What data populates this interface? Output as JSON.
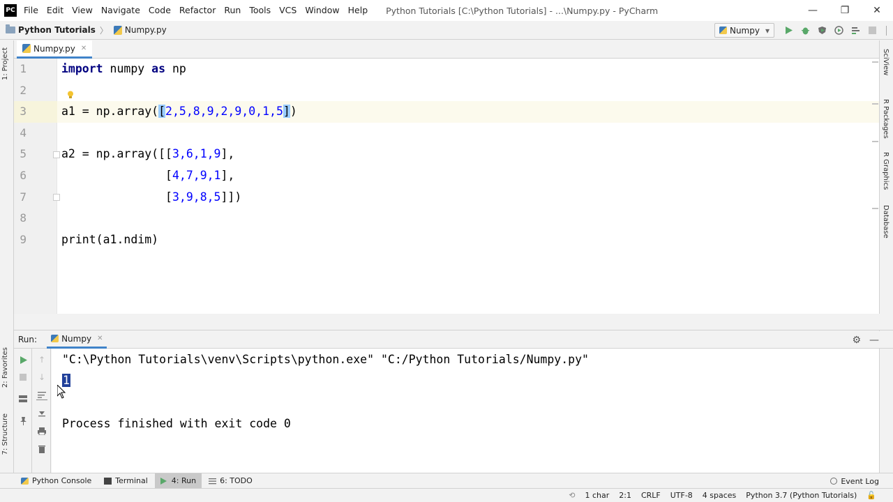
{
  "app": {
    "logo_text": "PC",
    "window_title": "Python Tutorials [C:\\Python Tutorials] - ...\\Numpy.py - PyCharm"
  },
  "menu": [
    "File",
    "Edit",
    "View",
    "Navigate",
    "Code",
    "Refactor",
    "Run",
    "Tools",
    "VCS",
    "Window",
    "Help"
  ],
  "window_controls": {
    "minimize": "—",
    "maximize": "❐",
    "close": "✕"
  },
  "breadcrumb": {
    "project": "Python Tutorials",
    "file": "Numpy.py"
  },
  "run_config": {
    "name": "Numpy",
    "arrow": "▾"
  },
  "toolbar_icons": [
    "run-icon",
    "debug-icon",
    "coverage-icon",
    "profile-icon",
    "concurrency-icon",
    "stop-icon"
  ],
  "left_stripe": {
    "project": "1: Project",
    "favorites": "2: Favorites",
    "structure": "7: Structure"
  },
  "right_stripe": {
    "sciview": "SciView",
    "r_packages": "R Packages",
    "r_graphics": "R Graphics",
    "database": "Database"
  },
  "editor_tab": {
    "label": "Numpy.py",
    "close": "✕"
  },
  "line_numbers": [
    "1",
    "2",
    "3",
    "4",
    "5",
    "6",
    "7",
    "8",
    "9"
  ],
  "code": {
    "l1_kw1": "import",
    "l1_mid": " numpy ",
    "l1_kw2": "as",
    "l1_end": " np",
    "l3_pre": "a1 = np.array(",
    "l3_open": "[",
    "l3_nums": "2,5,8,9,2,9,0,1,5",
    "l3_close": "]",
    "l3_end": ")",
    "l5_pre": "a2 = np.array([[",
    "l5_nums": "3,6,1,9",
    "l5_end": "],",
    "l6_pre": "               [",
    "l6_nums": "4,7,9,1",
    "l6_end": "],",
    "l7_pre": "               [",
    "l7_nums": "3,9,8,5",
    "l7_end": "]])",
    "l9": "print(a1.ndim)"
  },
  "run_panel": {
    "label": "Run:",
    "tab": "Numpy",
    "cmd": "\"C:\\Python Tutorials\\venv\\Scripts\\python.exe\" \"C:/Python Tutorials/Numpy.py\"",
    "output": "1",
    "exit": "Process finished with exit code 0"
  },
  "bottom_tabs": [
    {
      "label": "Python Console"
    },
    {
      "label": "Terminal"
    },
    {
      "label": "4: Run"
    },
    {
      "label": "6: TODO"
    }
  ],
  "event_log": "Event Log",
  "status": {
    "chars": "1 char",
    "position": "2:1",
    "line_sep": "CRLF",
    "encoding": "UTF-8",
    "indent": "4 spaces",
    "interpreter": "Python 3.7 (Python Tutorials)"
  },
  "colors": {
    "accent": "#4083c9",
    "keyword": "#000080",
    "number": "#0000ff",
    "selection": "#21409a"
  }
}
